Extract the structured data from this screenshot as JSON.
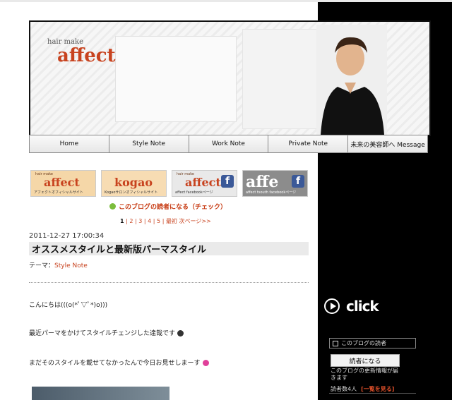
{
  "header": {
    "brand_small": "hair make",
    "brand": "affect"
  },
  "nav": [
    "Home",
    "Style Note",
    "Work Note",
    "Private Note",
    "未来の美容師へ Message"
  ],
  "banners": [
    {
      "small": "hair make",
      "main": "affect",
      "caption": "アフェクトオフィシャルサイト",
      "bg": "#f5d7a8"
    },
    {
      "small": "",
      "main": "kogao",
      "caption": "Kogaoサロンオフィシャルサイト",
      "bg": "#f7dcb3"
    },
    {
      "small": "hair make",
      "main": "affect",
      "caption": "affect facebookページ",
      "bg": "#e9e9e9",
      "fb": "f"
    },
    {
      "small": "",
      "main": "affe",
      "caption": "affect tsouth facebookページ",
      "bg": "#8c8c8c",
      "fb": "f"
    }
  ],
  "reader_link": "このブログの読者になる（チェック）",
  "pager": {
    "current": "1",
    "pages": [
      "2",
      "3",
      "4",
      "5"
    ],
    "last": "最初",
    "next": "次ページ>>"
  },
  "post": {
    "date": "2011-12-27 17:00:34",
    "title": "オススメスタイルと最新版パーマスタイル",
    "theme_label": "テーマ：",
    "theme_value": "Style Note",
    "paragraphs": [
      "こんにちは(((o(*ﾟ▽ﾟ*)o)))",
      "最近パーマをかけてスタイルチェンジした達哉です",
      "まだそのスタイルを載せてなかったんで今日お見せしまーす"
    ]
  },
  "sidebar": {
    "click_label": "click",
    "reader_header": "このブログの読者",
    "become_button": "読者になる",
    "notice": "このブログの更新情報が届きます",
    "count": "読者数4人",
    "list_link": "[一覧を見る]"
  },
  "colors": {
    "accent": "#c8431f",
    "sidebar_bg": "#000000",
    "facebook": "#3b5998"
  }
}
